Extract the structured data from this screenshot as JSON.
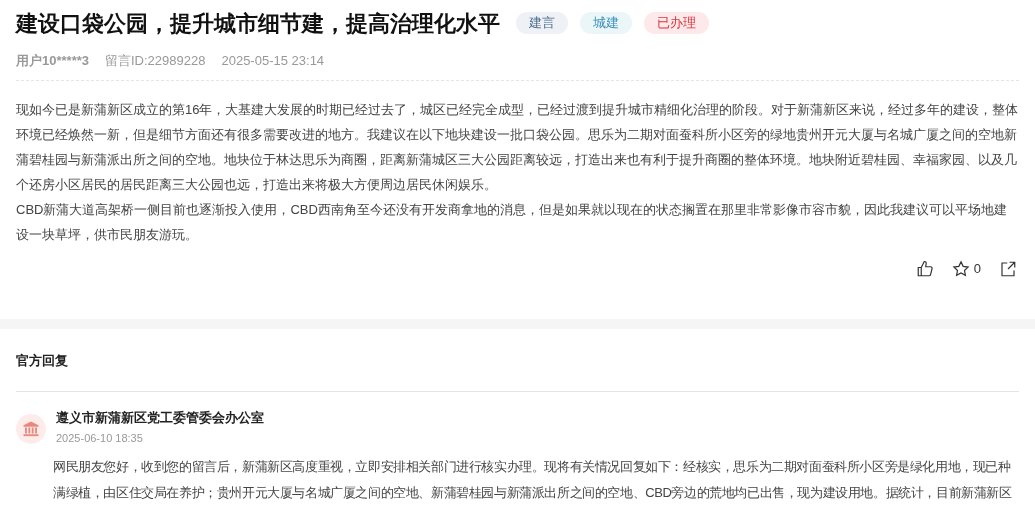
{
  "title": "建设口袋公园，提升城市细节建，提高治理化水平",
  "tags": [
    {
      "label": "建言",
      "color": "#4a6a8a"
    },
    {
      "label": "城建",
      "color": "#3a8fb7"
    },
    {
      "label": "已办理",
      "color": "#d9363e"
    }
  ],
  "meta": {
    "user": "用户10*****3",
    "message_id": "留言ID:22989228",
    "time": "2025-05-15 23:14"
  },
  "paragraphs": [
    "现如今已是新蒲新区成立的第16年，大基建大发展的时期已经过去了，城区已经完全成型，已经过渡到提升城市精细化治理的阶段。对于新蒲新区来说，经过多年的建设，整体环境已经焕然一新，但是细节方面还有很多需要改进的地方。我建议在以下地块建设一批口袋公园。思乐为二期对面蚕科所小区旁的绿地贵州开元大厦与名城广厦之间的空地新蒲碧桂园与新蒲派出所之间的空地。地块位于林达思乐为商圈，距离新蒲城区三大公园距离较远，打造出来也有利于提升商圈的整体环境。地块附近碧桂园、幸福家园、以及几个还房小区居民的居民距离三大公园也远，打造出来将极大方便周边居民休闲娱乐。",
    "CBD新蒲大道高架桥一侧目前也逐渐投入使用，CBD西南角至今还没有开发商拿地的消息，但是如果就以现在的状态搁置在那里非常影像市容市貌，因此我建议可以平场地建设一块草坪，供市民朋友游玩。"
  ],
  "actions": {
    "favorite_count": "0"
  },
  "reply_section": {
    "heading": "官方回复",
    "org": "遵义市新蒲新区党工委管委会办公室",
    "time": "2025-06-10 18:35",
    "text": "网民朋友您好，收到您的留言后，新蒲新区高度重视，立即安排相关部门进行核实办理。现将有关情况回复如下：经核实，思乐为二期对面蚕科所小区旁是绿化用地，现已种满绿植，由区住交局在养护；贵州开元大厦与名城广厦之间的空地、新蒲碧桂园与新蒲派出所之间的空地、CBD旁边的荒地均已出售，现为建设用地。据统计，目前新蒲新区"
  }
}
